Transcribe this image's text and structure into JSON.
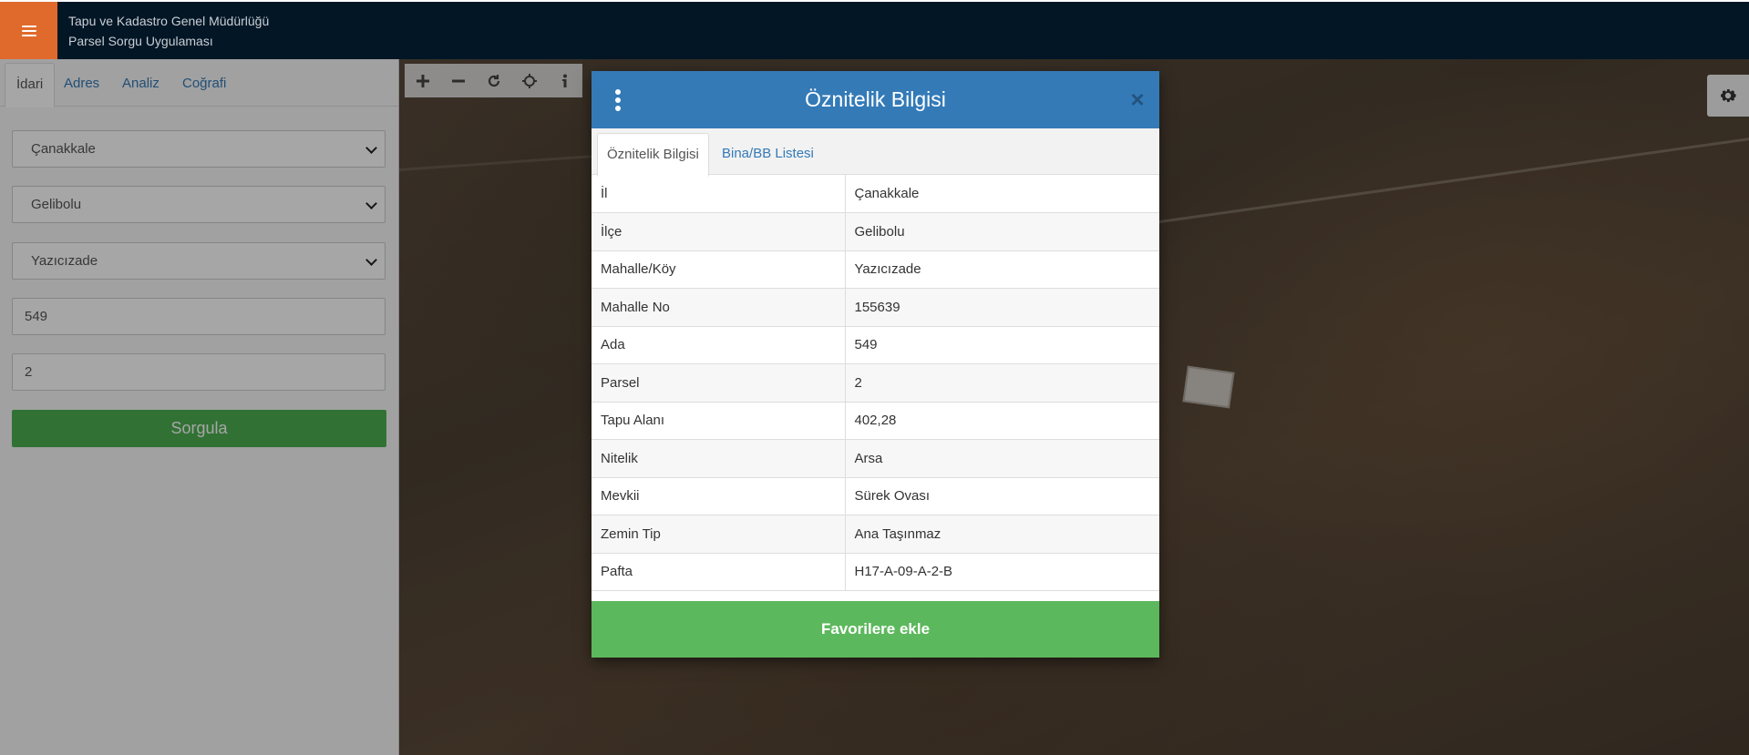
{
  "header": {
    "org": "Tapu ve Kadastro Genel Müdürlüğü",
    "app": "Parsel Sorgu Uygulaması",
    "menu_icon": "hamburger-menu-icon",
    "accent_color": "#e06a2c",
    "bg_color": "#031626"
  },
  "sidebar": {
    "tabs": [
      {
        "label": "İdari",
        "active": true
      },
      {
        "label": "Adres",
        "active": false
      },
      {
        "label": "Analiz",
        "active": false
      },
      {
        "label": "Coğrafi",
        "active": false
      }
    ],
    "il_select": "Çanakkale",
    "ilce_select": "Gelibolu",
    "mahalle_select": "Yazıcızade",
    "ada_input": "549",
    "parsel_input": "2",
    "submit_label": "Sorgula"
  },
  "map": {
    "tools": [
      "zoom-in-icon",
      "zoom-out-icon",
      "refresh-icon",
      "locate-icon",
      "info-icon"
    ],
    "settings_icon": "gear-icon"
  },
  "modal": {
    "title": "Öznitelik Bilgisi",
    "tabs": [
      {
        "label": "Öznitelik Bilgisi",
        "active": true
      },
      {
        "label": "Bina/BB Listesi",
        "active": false
      }
    ],
    "rows": [
      {
        "key": "İl",
        "value": "Çanakkale"
      },
      {
        "key": "İlçe",
        "value": "Gelibolu"
      },
      {
        "key": "Mahalle/Köy",
        "value": "Yazıcızade"
      },
      {
        "key": "Mahalle No",
        "value": "155639"
      },
      {
        "key": "Ada",
        "value": "549"
      },
      {
        "key": "Parsel",
        "value": "2"
      },
      {
        "key": "Tapu Alanı",
        "value": "402,28"
      },
      {
        "key": "Nitelik",
        "value": "Arsa"
      },
      {
        "key": "Mevkii",
        "value": "Sürek Ovası"
      },
      {
        "key": "Zemin Tip",
        "value": "Ana Taşınmaz"
      },
      {
        "key": "Pafta",
        "value": "H17-A-09-A-2-B"
      }
    ],
    "favorite_label": "Favorilere ekle",
    "header_color": "#337ab7",
    "button_color": "#5cb85c"
  }
}
